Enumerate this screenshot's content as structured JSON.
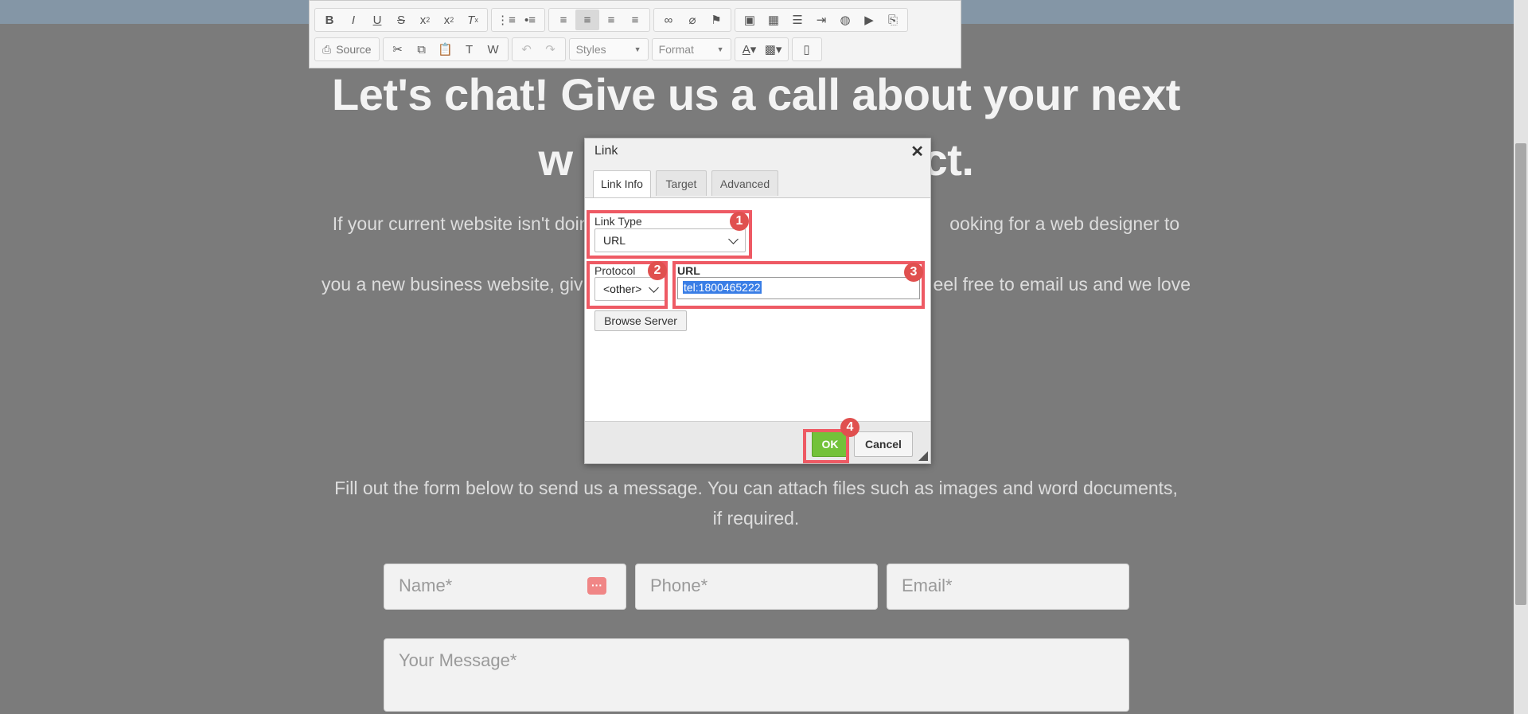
{
  "toolbar": {
    "source_label": "Source",
    "styles_label": "Styles",
    "format_label": "Format"
  },
  "page": {
    "heading_line1": "Let's chat! Give us a call about your next",
    "heading_line2_left": "w",
    "heading_line2_right": "ct.",
    "para_line1_left": "If your current website isn't doing",
    "para_line1_right": "ooking for a web designer to build",
    "para_line2_left": "you a new business website, giv",
    "para_line2_right": "eel free to email us and we love",
    "para2": "Fill out the form below to send us a message. You can attach files such as images and word documents, if required.",
    "name_placeholder": "Name*",
    "phone_placeholder": "Phone*",
    "email_placeholder": "Email*",
    "message_placeholder": "Your Message*"
  },
  "dialog": {
    "title": "Link",
    "tabs": [
      "Link Info",
      "Target",
      "Advanced"
    ],
    "link_type_label": "Link Type",
    "link_type_value": "URL",
    "protocol_label": "Protocol",
    "protocol_value": "<other>",
    "url_label": "URL",
    "url_value": "tel:1800465222",
    "browse_label": "Browse Server",
    "ok_label": "OK",
    "cancel_label": "Cancel"
  },
  "annotations": {
    "badges": [
      "1",
      "2",
      "3",
      "4"
    ],
    "highlight_color": "#ee5a64",
    "badge_color": "#e0504f"
  },
  "colors": {
    "ok_green": "#73c23a",
    "selection_blue": "#3a7ee6"
  }
}
